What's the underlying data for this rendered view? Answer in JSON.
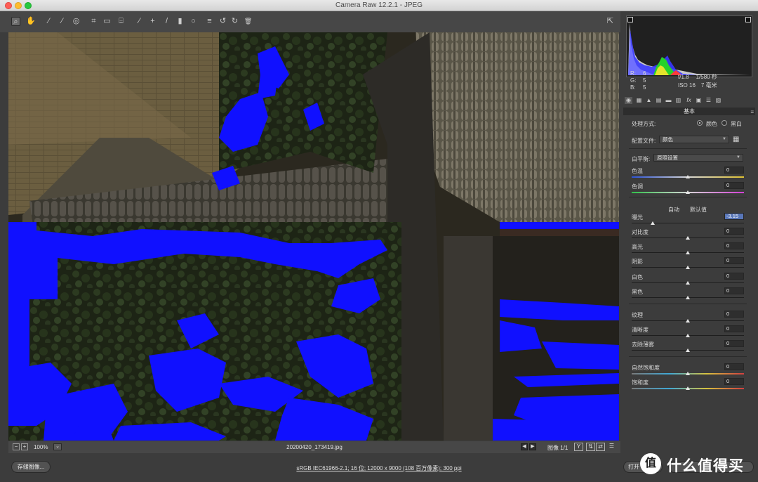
{
  "window": {
    "title": "Camera Raw 12.2.1 -  JPEG"
  },
  "toolbar": {
    "tools": [
      {
        "name": "zoom-tool",
        "icon": "magnifier-icon",
        "glyph": "⌕"
      },
      {
        "name": "hand-tool",
        "icon": "hand-icon",
        "glyph": "✋"
      },
      {
        "name": "white-balance-tool",
        "icon": "eyedropper-icon",
        "glyph": "⁄"
      },
      {
        "name": "color-sampler-tool",
        "icon": "color-sampler-icon",
        "glyph": "⁄"
      },
      {
        "name": "targeted-adjustment-tool",
        "icon": "target-adjust-icon",
        "glyph": "◎"
      },
      {
        "name": "crop-tool",
        "icon": "crop-icon",
        "glyph": "⌗"
      },
      {
        "name": "straighten-tool",
        "icon": "straighten-icon",
        "glyph": "▭"
      },
      {
        "name": "transform-tool",
        "icon": "transform-icon",
        "glyph": "⌸"
      },
      {
        "name": "spot-removal-tool",
        "icon": "spot-removal-icon",
        "glyph": "⁄"
      },
      {
        "name": "red-eye-tool",
        "icon": "red-eye-icon",
        "glyph": "+"
      },
      {
        "name": "adjustment-brush-tool",
        "icon": "brush-icon",
        "glyph": "/"
      },
      {
        "name": "graduated-filter-tool",
        "icon": "graduated-filter-icon",
        "glyph": "▮"
      },
      {
        "name": "radial-filter-tool",
        "icon": "radial-filter-icon",
        "glyph": "○"
      },
      {
        "name": "preferences-tool",
        "icon": "list-icon",
        "glyph": "≡"
      },
      {
        "name": "rotate-left-tool",
        "icon": "rotate-left-icon",
        "glyph": "↺"
      },
      {
        "name": "rotate-right-tool",
        "icon": "rotate-right-icon",
        "glyph": "↻"
      },
      {
        "name": "delete-tool",
        "icon": "trash-icon",
        "glyph": "🗑"
      }
    ],
    "fullscreen_glyph": "⇱"
  },
  "histogram": {
    "r_label": "R:",
    "r_value": "6",
    "g_label": "G:",
    "g_value": "5",
    "b_label": "B:",
    "b_value": "5",
    "aperture": "f/1.8",
    "shutter": "1/580 秒",
    "iso": "ISO 16",
    "focal": "7 毫米"
  },
  "panel": {
    "section_title": "基本",
    "section_menu_glyph": "≡",
    "treatment_label": "处理方式:",
    "treatment_color": "颜色",
    "treatment_bw": "黑白",
    "profile_label": "配置文件:",
    "profile_value": "颜色",
    "wb_label": "白平衡:",
    "wb_value": "原照设置",
    "auto_link": "自动",
    "default_link": "默认值",
    "sliders": [
      {
        "key": "temp",
        "label": "色温",
        "value": "0",
        "level": 0.5
      },
      {
        "key": "tint",
        "label": "色调",
        "value": "0",
        "level": 0.5
      },
      {
        "key": "exposure",
        "label": "曝光",
        "value": "-3.15",
        "level": 0.185
      },
      {
        "key": "contrast",
        "label": "对比度",
        "value": "0",
        "level": 0.5
      },
      {
        "key": "highlights",
        "label": "高光",
        "value": "0",
        "level": 0.5
      },
      {
        "key": "shadows",
        "label": "阴影",
        "value": "0",
        "level": 0.5
      },
      {
        "key": "whites",
        "label": "白色",
        "value": "0",
        "level": 0.5
      },
      {
        "key": "blacks",
        "label": "黑色",
        "value": "0",
        "level": 0.5
      },
      {
        "key": "texture",
        "label": "纹理",
        "value": "0",
        "level": 0.5
      },
      {
        "key": "clarity",
        "label": "清晰度",
        "value": "0",
        "level": 0.5
      },
      {
        "key": "dehaze",
        "label": "去除薄雾",
        "value": "0",
        "level": 0.5
      },
      {
        "key": "vibrance",
        "label": "自然饱和度",
        "value": "0",
        "level": 0.5
      },
      {
        "key": "saturation",
        "label": "饱和度",
        "value": "0",
        "level": 0.5
      }
    ]
  },
  "status": {
    "zoom_out": "−",
    "zoom_in": "+",
    "zoom": "100%",
    "filename": "20200420_173419.jpg",
    "prev": "◀",
    "next": "▶",
    "image_counter": "图像 1/1",
    "y_button": "Y"
  },
  "footer": {
    "save_label": "存储图像...",
    "workflow_info": "sRGB IEC61966-2.1; 16 位; 12000 x 9000 (108 百万像素); 300 ppi",
    "open_label": "打开",
    "watermark_text": "什么值得买",
    "watermark_logo": "值"
  },
  "colors": {
    "clipping_overlay": "#1010ff",
    "selection_highlight": "#5876b8"
  }
}
